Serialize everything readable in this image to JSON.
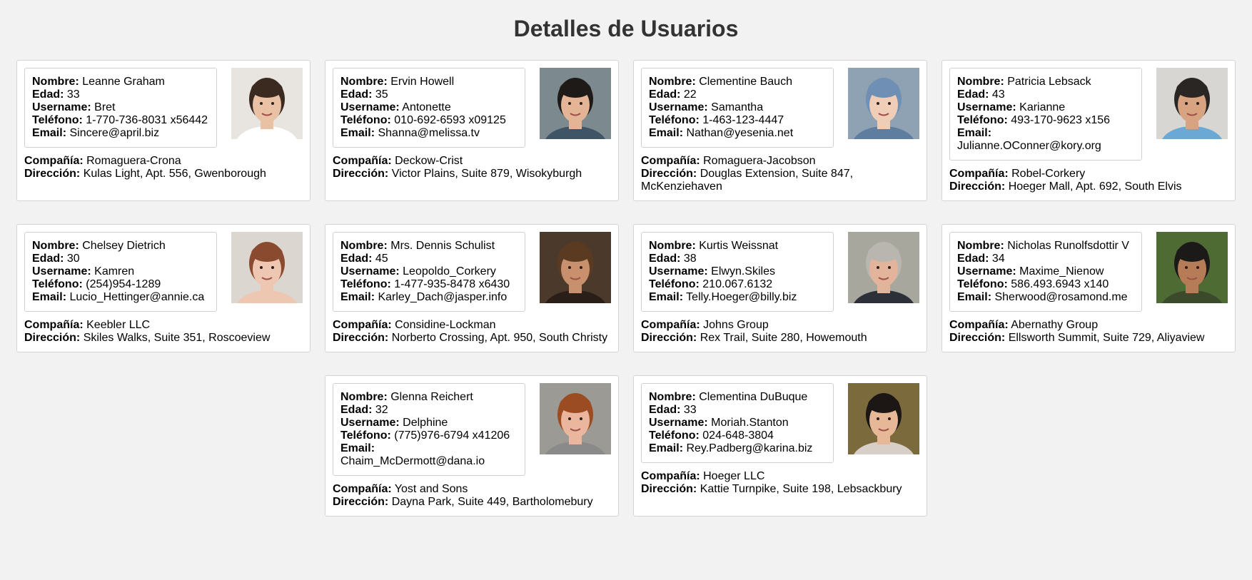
{
  "page": {
    "title": "Detalles de Usuarios"
  },
  "labels": {
    "name": "Nombre:",
    "age": "Edad:",
    "username": "Username:",
    "phone": "Teléfono:",
    "email": "Email:",
    "company": "Compañía:",
    "address": "Dirección:"
  },
  "users": [
    {
      "name": "Leanne Graham",
      "age": "33",
      "username": "Bret",
      "phone": "1-770-736-8031 x56442",
      "email": "Sincere@april.biz",
      "company": "Romaguera-Crona",
      "address": "Kulas Light, Apt. 556, Gwenborough",
      "photo": {
        "bg": "#e8e4e0",
        "skin": "#e9c2a6",
        "hair": "#3a2a20",
        "shirt": "#ffffff"
      }
    },
    {
      "name": "Ervin Howell",
      "age": "35",
      "username": "Antonette",
      "phone": "010-692-6593 x09125",
      "email": "Shanna@melissa.tv",
      "company": "Deckow-Crist",
      "address": "Victor Plains, Suite 879, Wisokyburgh",
      "photo": {
        "bg": "#7c8a8f",
        "skin": "#e3b596",
        "hair": "#1e1a18",
        "shirt": "#3f5566"
      }
    },
    {
      "name": "Clementine Bauch",
      "age": "22",
      "username": "Samantha",
      "phone": "1-463-123-4447",
      "email": "Nathan@yesenia.net",
      "company": "Romaguera-Jacobson",
      "address": "Douglas Extension, Suite 847, McKenziehaven",
      "photo": {
        "bg": "#8fa2b4",
        "skin": "#efcdb6",
        "hair": "#6f8fb4",
        "shirt": "#5f7d9e"
      }
    },
    {
      "name": "Patricia Lebsack",
      "age": "43",
      "username": "Karianne",
      "phone": "493-170-9623 x156",
      "email": "Julianne.OConner@kory.org",
      "company": "Robel-Corkery",
      "address": "Hoeger Mall, Apt. 692, South Elvis",
      "photo": {
        "bg": "#d8d6d2",
        "skin": "#d7a381",
        "hair": "#2a2624",
        "shirt": "#6aa9d6"
      }
    },
    {
      "name": "Chelsey Dietrich",
      "age": "30",
      "username": "Kamren",
      "phone": "(254)954-1289",
      "email": "Lucio_Hettinger@annie.ca",
      "company": "Keebler LLC",
      "address": "Skiles Walks, Suite 351, Roscoeview",
      "photo": {
        "bg": "#dcd6d0",
        "skin": "#eec7b3",
        "hair": "#8a4a30",
        "shirt": "#eec7b3"
      }
    },
    {
      "name": "Mrs. Dennis Schulist",
      "age": "45",
      "username": "Leopoldo_Corkery",
      "phone": "1-477-935-8478 x6430",
      "email": "Karley_Dach@jasper.info",
      "company": "Considine-Lockman",
      "address": "Norberto Crossing, Apt. 950, South Christy",
      "photo": {
        "bg": "#4b3a2c",
        "skin": "#c8906c",
        "hair": "#5b3a22",
        "shirt": "#2a1e18"
      }
    },
    {
      "name": "Kurtis Weissnat",
      "age": "38",
      "username": "Elwyn.Skiles",
      "phone": "210.067.6132",
      "email": "Telly.Hoeger@billy.biz",
      "company": "Johns Group",
      "address": "Rex Trail, Suite 280, Howemouth",
      "photo": {
        "bg": "#a7a79d",
        "skin": "#e2b49c",
        "hair": "#b9b6b0",
        "shirt": "#2c3038"
      }
    },
    {
      "name": "Nicholas Runolfsdottir V",
      "age": "34",
      "username": "Maxime_Nienow",
      "phone": "586.493.6943 x140",
      "email": "Sherwood@rosamond.me",
      "company": "Abernathy Group",
      "address": "Ellsworth Summit, Suite 729, Aliyaview",
      "photo": {
        "bg": "#4f6b34",
        "skin": "#b67c58",
        "hair": "#1c1a18",
        "shirt": "#3a4a2a"
      }
    },
    {
      "name": "Glenna Reichert",
      "age": "32",
      "username": "Delphine",
      "phone": "(775)976-6794 x41206",
      "email": "Chaim_McDermott@dana.io",
      "company": "Yost and Sons",
      "address": "Dayna Park, Suite 449, Bartholomebury",
      "photo": {
        "bg": "#9c9a95",
        "skin": "#eab79e",
        "hair": "#9b4c22",
        "shirt": "#8a8a8a"
      }
    },
    {
      "name": "Clementina DuBuque",
      "age": "33",
      "username": "Moriah.Stanton",
      "phone": "024-648-3804",
      "email": "Rey.Padberg@karina.biz",
      "company": "Hoeger LLC",
      "address": "Kattie Turnpike, Suite 198, Lebsackbury",
      "photo": {
        "bg": "#7a6a3c",
        "skin": "#e6b898",
        "hair": "#1c1614",
        "shirt": "#d8d0c8"
      }
    }
  ]
}
